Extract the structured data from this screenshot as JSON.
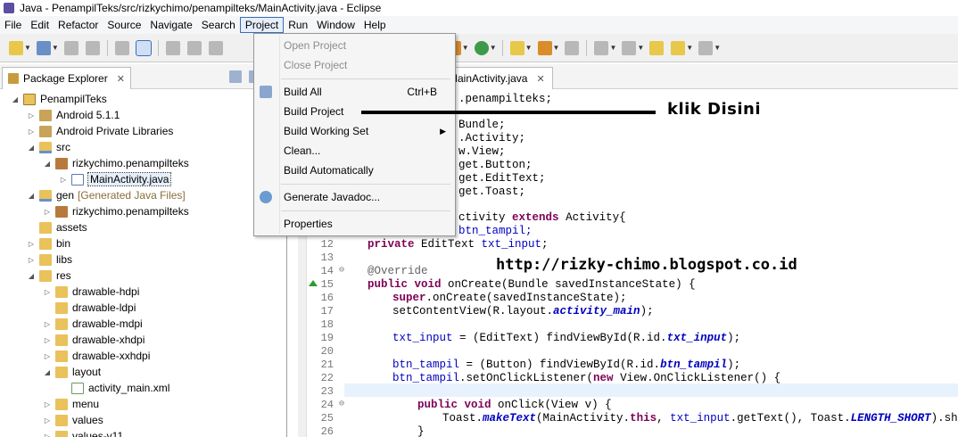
{
  "window": {
    "title": "Java - PenampilTeks/src/rizkychimo/penampilteks/MainActivity.java - Eclipse"
  },
  "menubar": [
    "File",
    "Edit",
    "Refactor",
    "Source",
    "Navigate",
    "Search",
    "Project",
    "Run",
    "Window",
    "Help"
  ],
  "package_explorer": {
    "title": "Package Explorer",
    "close": "✕",
    "tree": [
      {
        "label": "PenampilTeks"
      },
      {
        "label": "Android 5.1.1"
      },
      {
        "label": "Android Private Libraries"
      },
      {
        "label": "src"
      },
      {
        "label": "rizkychimo.penampilteks"
      },
      {
        "label": "MainActivity.java"
      },
      {
        "label": "gen",
        "note": "[Generated Java Files]"
      },
      {
        "label": "rizkychimo.penampilteks"
      },
      {
        "label": "assets"
      },
      {
        "label": "bin"
      },
      {
        "label": "libs"
      },
      {
        "label": "res"
      },
      {
        "label": "drawable-hdpi"
      },
      {
        "label": "drawable-ldpi"
      },
      {
        "label": "drawable-mdpi"
      },
      {
        "label": "drawable-xhdpi"
      },
      {
        "label": "drawable-xxhdpi"
      },
      {
        "label": "layout"
      },
      {
        "label": "activity_main.xml"
      },
      {
        "label": "menu"
      },
      {
        "label": "values"
      },
      {
        "label": "values-v11"
      }
    ]
  },
  "editor": {
    "tab": "MainActivity.java",
    "close": "✕",
    "line_numbers": [
      "12",
      "13",
      "14",
      "15",
      "16",
      "17",
      "18",
      "19",
      "20",
      "21",
      "22",
      "23",
      "24",
      "25",
      "26"
    ],
    "code": {
      "l_pkg": ".penampilteks;",
      "l_i1": "Bundle;",
      "l_i2": ".Activity;",
      "l_i3": "w.View;",
      "l_i4": "get.Button;",
      "l_i5": "get.EditText;",
      "l_i6": "get.Toast;",
      "l_cls_kw": "ctivity",
      "l_cls_ext": "extends",
      "l_cls_rest": "Activity{",
      "l_btn": "btn_tampil;",
      "l_12_kw": "private",
      "l_12_rest": " EditText ",
      "l_12_fd": "txt_input",
      "l_12_end": ";",
      "l_14": "@Override",
      "l_15_kw1": "public",
      "l_15_kw2": "void",
      "l_15_rest": " onCreate(Bundle savedInstanceState) {",
      "l_16_kw": "super",
      "l_16_rest": ".onCreate(savedInstanceState);",
      "l_17_a": "setContentView(R.layout.",
      "l_17_it": "activity_main",
      "l_17_b": ");",
      "l_19_fd": "txt_input",
      "l_19_a": " = (EditText) findViewById(R.id.",
      "l_19_it": "txt_input",
      "l_19_b": ");",
      "l_21_fd": "btn_tampil",
      "l_21_a": " = (Button) findViewById(R.id.",
      "l_21_it": "btn_tampil",
      "l_21_b": ");",
      "l_22_fd": "btn_tampil",
      "l_22_a": ".setOnClickListener(",
      "l_22_kw": "new",
      "l_22_b": " View.OnClickListener() {",
      "l_24_kw1": "public",
      "l_24_kw2": "void",
      "l_24_rest": " onClick(View v) {",
      "l_25_a": "Toast.",
      "l_25_it1": "makeText",
      "l_25_b": "(MainActivity.",
      "l_25_kw": "this",
      "l_25_c": ", ",
      "l_25_fd": "txt_input",
      "l_25_d": ".getText(), Toast.",
      "l_25_it2": "LENGTH_SHORT",
      "l_25_e": ").show();",
      "l_26": "}"
    }
  },
  "project_menu": {
    "open_project": "Open Project",
    "close_project": "Close Project",
    "build_all": "Build All",
    "build_all_acc": "Ctrl+B",
    "build_project": "Build Project",
    "build_working_set": "Build Working Set",
    "clean": "Clean...",
    "build_automatically": "Build Automatically",
    "generate_javadoc": "Generate Javadoc...",
    "properties": "Properties"
  },
  "annotations": {
    "click_here": "klik  Disini",
    "blog_url": "http://rizky-chimo.blogspot.co.id"
  },
  "colors": {
    "keyword": "#7f0055",
    "field": "#0000c0",
    "menu_highlight": "#3b6fb6",
    "current_line": "#e8f2fe"
  }
}
